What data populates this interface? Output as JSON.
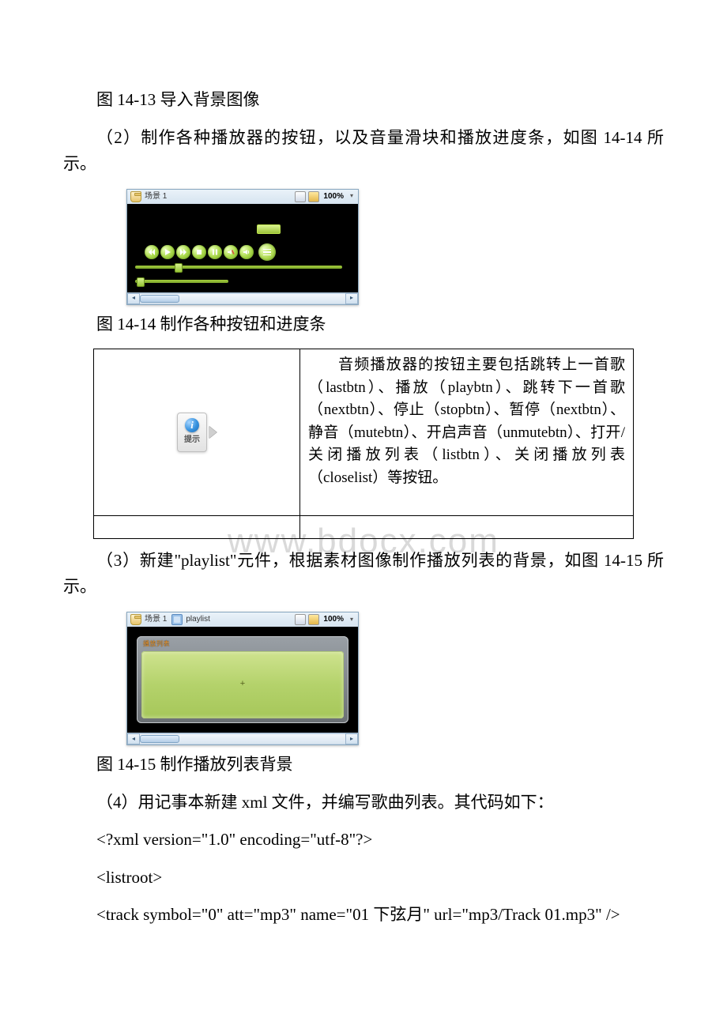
{
  "fig13_caption": "图 14-13 导入背景图像",
  "para2_prefix": "（2）制作各种播放器的按钮，以及音量滑块和播放进度条，如图 14-14 所示。",
  "fig14": {
    "crumb1": "场景 1",
    "zoom": "100%",
    "caption": "图 14-14 制作各种按钮和进度条"
  },
  "tip": {
    "label": "提示",
    "text": "音频播放器的按钮主要包括跳转上一首歌（lastbtn）、播放（playbtn）、跳转下一首歌（nextbtn）、停止（stopbtn）、暂停（nextbtn）、静音（mutebtn）、开启声音（unmutebtn）、打开/关闭播放列表（listbtn）、关闭播放列表（closelist）等按钮。"
  },
  "watermark": "www.bdocx.com",
  "para3": "（3）新建\"playlist\"元件，根据素材图像制作播放列表的背景，如图 14-15 所示。",
  "fig15": {
    "crumb1": "场景 1",
    "crumb2": "playlist",
    "zoom": "100%",
    "pl_title": "播放列表",
    "center": "+",
    "caption": "图 14-15 制作播放列表背景"
  },
  "para4": "（4）用记事本新建 xml 文件，并编写歌曲列表。其代码如下：",
  "code1": "<?xml version=\"1.0\" encoding=\"utf-8\"?>",
  "code2": "<listroot>",
  "code3": " <track symbol=\"0\" att=\"mp3\" name=\"01 下弦月\" url=\"mp3/Track 01.mp3\" />"
}
